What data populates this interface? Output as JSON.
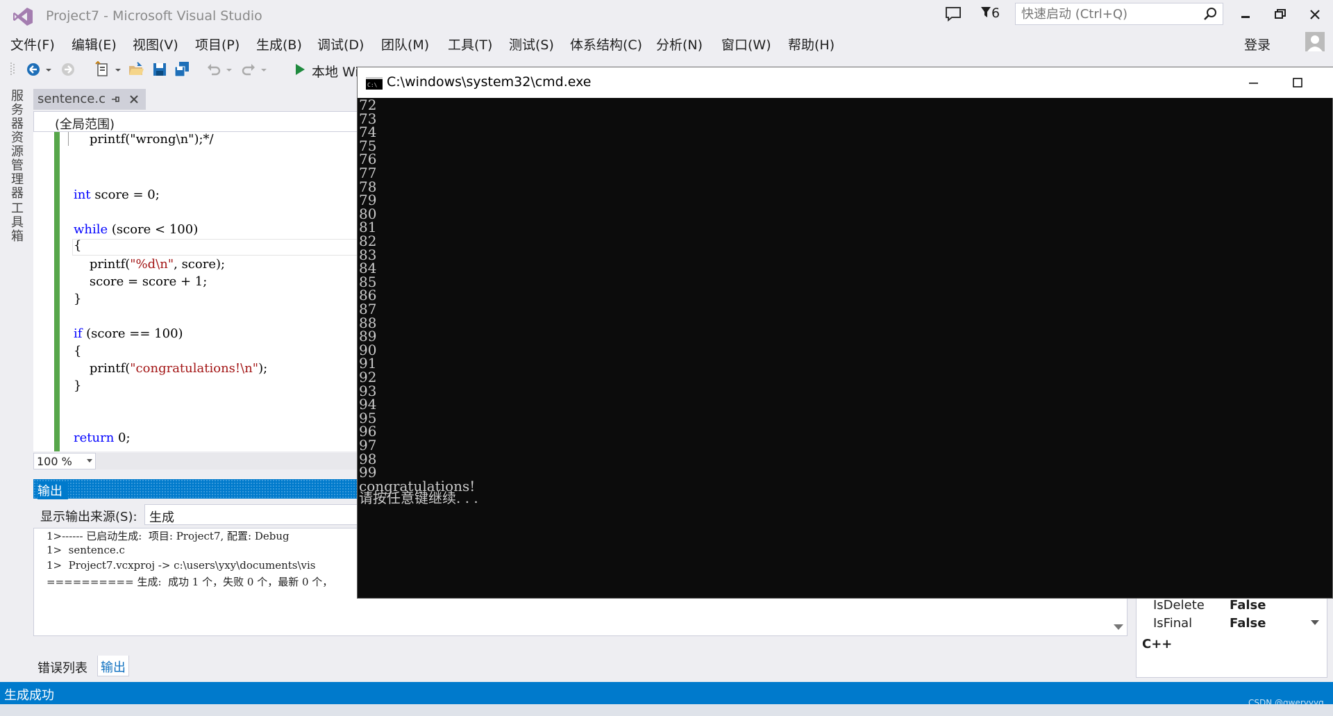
{
  "window": {
    "title": "Project7 - Microsoft Visual Studio",
    "notification_count": "6",
    "quick_launch_placeholder": "快速启动 (Ctrl+Q)",
    "sign_in": "登录"
  },
  "menu": [
    "文件(F)",
    "编辑(E)",
    "视图(V)",
    "项目(P)",
    "生成(B)",
    "调试(D)",
    "团队(M)",
    "工具(T)",
    "测试(S)",
    "体系结构(C)",
    "分析(N)",
    "窗口(W)",
    "帮助(H)"
  ],
  "toolbar": {
    "run_label": "本地 Wi"
  },
  "side_tabs": [
    "服务器资源管理器",
    "工具箱"
  ],
  "editor": {
    "tab_label": "sentence.c",
    "scope": "(全局范围)",
    "zoom": "100 %"
  },
  "output": {
    "title": "输出",
    "source_label": "显示输出来源(S):",
    "source_value": "生成",
    "lines": [
      "1>------ 已启动生成:  项目: Project7, 配置: Debug",
      "1>  sentence.c",
      "1>  Project7.vcxproj -> c:\\users\\yxy\\documents\\vis",
      "========== 生成:  成功 1 个，失败 0 个，最新 0 个，"
    ],
    "tabs": [
      "错误列表",
      "输出"
    ]
  },
  "properties": {
    "rows": [
      {
        "name": "IsDelete",
        "value": "False"
      },
      {
        "name": "IsFinal",
        "value": "False"
      }
    ],
    "language": "C++"
  },
  "status": {
    "text": "生成成功"
  },
  "watermark": "CSDN @qweryyyg",
  "console": {
    "title": "C:\\windows\\system32\\cmd.exe",
    "numbers": [
      "72",
      "73",
      "74",
      "75",
      "76",
      "77",
      "78",
      "79",
      "80",
      "81",
      "82",
      "83",
      "84",
      "85",
      "86",
      "87",
      "88",
      "89",
      "90",
      "91",
      "92",
      "93",
      "94",
      "95",
      "96",
      "97",
      "98",
      "99"
    ],
    "final_message": "congratulations!",
    "prompt": "请按任意键继续. . ."
  },
  "colors": {
    "accent": "#007acc",
    "keyword": "#0000ff",
    "string": "#a31515",
    "console_bg": "#0c0c0c"
  }
}
